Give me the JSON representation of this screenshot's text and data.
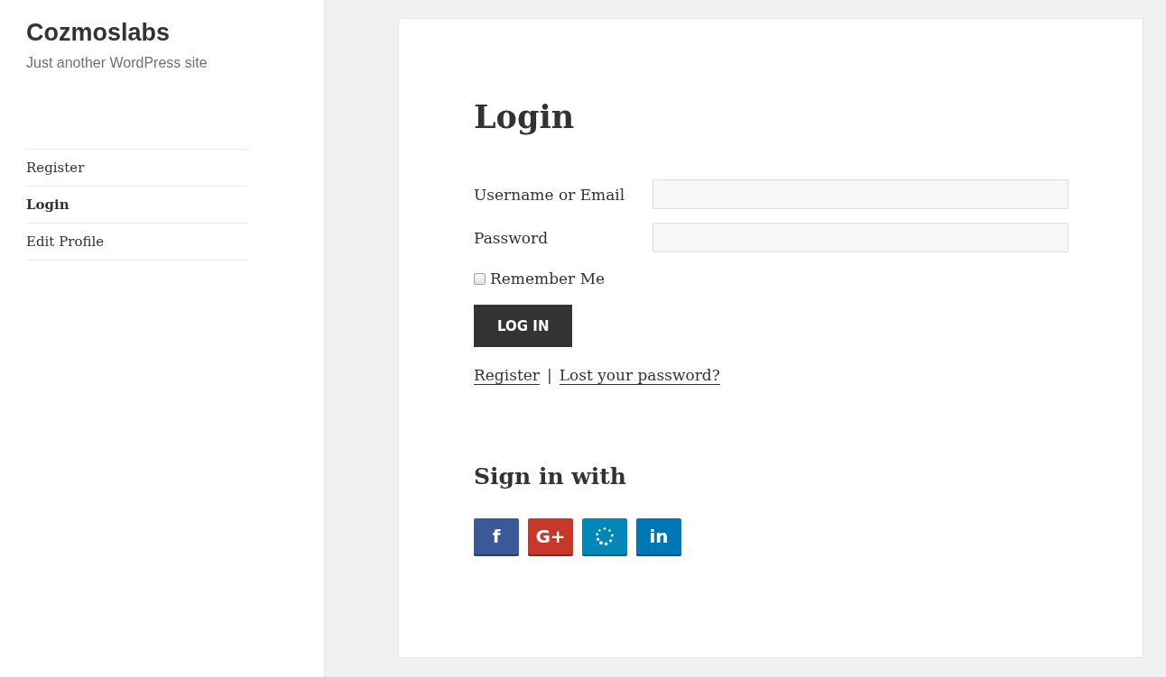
{
  "site": {
    "title": "Cozmoslabs",
    "tagline": "Just another WordPress site"
  },
  "nav": [
    {
      "label": "Register",
      "selected": false
    },
    {
      "label": "Login",
      "selected": true
    },
    {
      "label": "Edit Profile",
      "selected": false
    }
  ],
  "login": {
    "heading": "Login",
    "fields": [
      {
        "label": "Username or Email"
      },
      {
        "label": "Password"
      }
    ],
    "remember": {
      "label": "Remember Me",
      "checked": false
    },
    "submit": "LOG IN",
    "links": [
      {
        "kind": "link",
        "text": "Register"
      },
      {
        "kind": "separator",
        "text": "|"
      },
      {
        "kind": "link",
        "text": "Lost your password?"
      }
    ]
  },
  "social": {
    "heading": "Sign in with",
    "buttons": [
      {
        "kind": "letter",
        "label": "f",
        "color": "#3b5998"
      },
      {
        "kind": "letter",
        "label": "G+",
        "color": "#c5382a"
      },
      {
        "kind": "dots",
        "color": "#0087b7"
      },
      {
        "kind": "letter",
        "label": "in",
        "color": "#0077b5"
      }
    ]
  }
}
